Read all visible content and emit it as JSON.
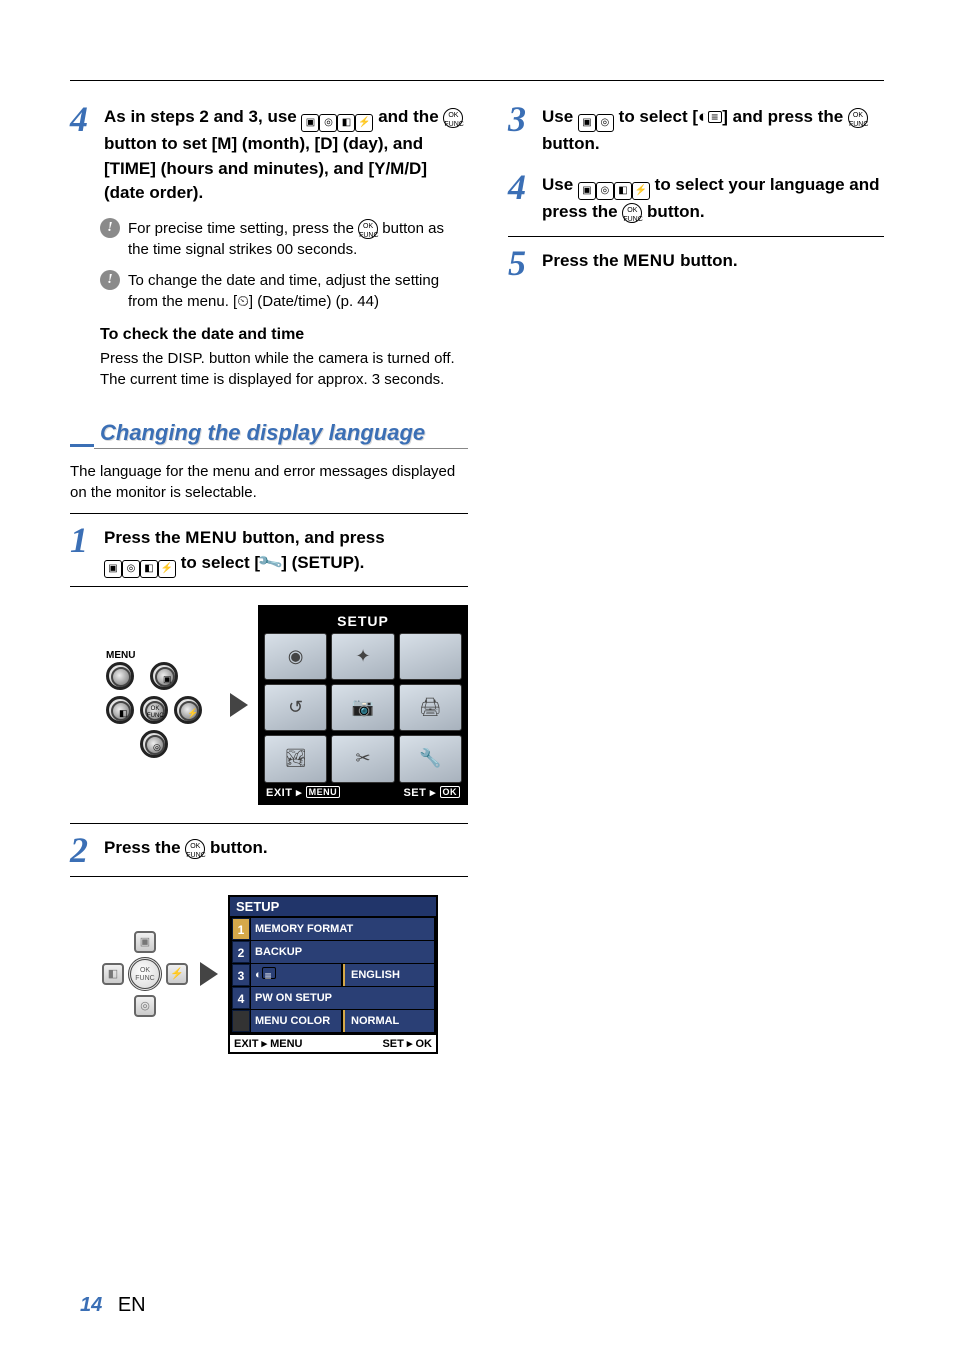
{
  "left": {
    "step4": {
      "num": "4",
      "text_pre": "As in steps 2 and 3, use ",
      "text_mid1": " and the ",
      "text_mid2": " button to set [M] (month), [D] (day), and [TIME] (hours and minutes), and [Y/M/D] (date order)."
    },
    "tip1": {
      "pre": "For precise time setting, press the ",
      "post": " button as the time signal strikes 00 seconds."
    },
    "tip2_pre": "To change the date and time, adjust the setting from the menu. [",
    "tip2_post": "] (Date/time) (p. 44)",
    "check_head": "To check the date and time",
    "check_body_pre": "Press the ",
    "check_body_disp": "DISP.",
    "check_body_post": " button while the camera is turned off. The current time is displayed for approx. 3 seconds.",
    "section_title": "Changing the display language",
    "section_body": "The language for the menu and error messages displayed on the monitor is selectable.",
    "step1": {
      "num": "1",
      "line1_pre": "Press the ",
      "line1_menu": "MENU",
      "line1_post": " button, and press ",
      "line2": " to select [",
      "line2_post": "] (SETUP)."
    },
    "setup_screen": {
      "title": "SETUP",
      "exit": "EXIT",
      "menu": "MENU",
      "set": "SET",
      "ok": "OK"
    },
    "ctrl_menu_label": "MENU",
    "step2": {
      "num": "2",
      "pre": "Press the ",
      "post": " button."
    },
    "setup_list": {
      "title": "SETUP",
      "rows": [
        {
          "n": "1",
          "label": "MEMORY FORMAT",
          "value": null
        },
        {
          "n": "2",
          "label": "BACKUP",
          "value": null
        },
        {
          "n": "3",
          "label": "",
          "value": "ENGLISH",
          "icon": true
        },
        {
          "n": "4",
          "label": "PW ON SETUP",
          "value": null
        },
        {
          "n": "",
          "label": "MENU COLOR",
          "value": "NORMAL"
        }
      ],
      "exit": "EXIT",
      "menu": "MENU",
      "set": "SET",
      "ok": "OK"
    }
  },
  "right": {
    "step3": {
      "num": "3",
      "pre": "Use ",
      "mid": " to select [",
      "post": "] and press the ",
      "end": " button."
    },
    "step4": {
      "num": "4",
      "pre": "Use ",
      "mid": " to select your language and press the ",
      "end": " button."
    },
    "step5": {
      "num": "5",
      "pre": "Press the ",
      "menu": "MENU",
      "post": " button."
    }
  },
  "footer": {
    "page": "14",
    "lang": "EN"
  },
  "glyphs": {
    "ok_func": "OK\nFUNC",
    "clock": "☀",
    "bullet": "!"
  }
}
